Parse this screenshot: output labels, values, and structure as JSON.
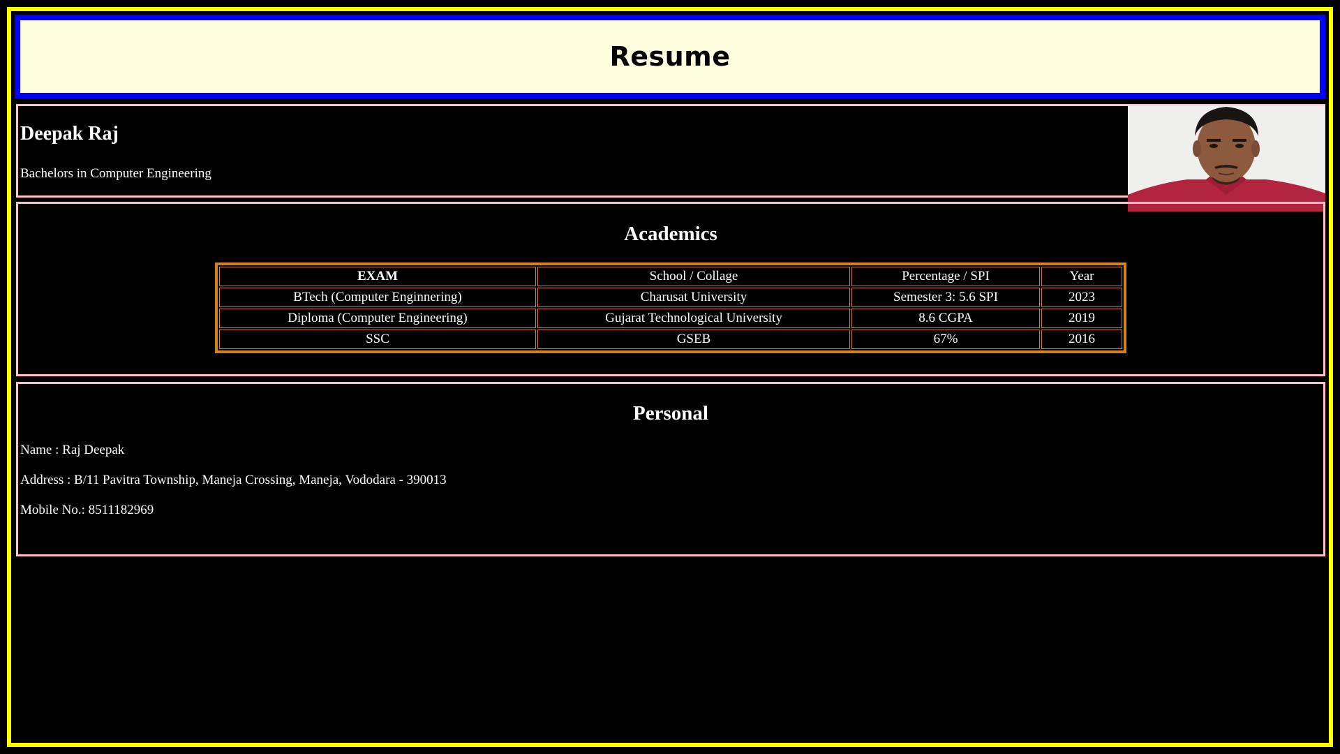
{
  "header": {
    "title": "Resume"
  },
  "profile": {
    "name": "Deepak Raj",
    "degree": "Bachelors in Computer Engineering"
  },
  "academics": {
    "heading": "Academics",
    "columns": [
      "EXAM",
      "School / Collage",
      "Percentage / SPI",
      "Year"
    ],
    "rows": [
      [
        "BTech (Computer Enginnering)",
        "Charusat University",
        "Semester 3: 5.6 SPI",
        "2023"
      ],
      [
        "Diploma (Computer Engineering)",
        "Gujarat Technological University",
        "8.6 CGPA",
        "2019"
      ],
      [
        "SSC",
        "GSEB",
        "67%",
        "2016"
      ]
    ]
  },
  "personal": {
    "heading": "Personal",
    "name_line": "Name : Raj Deepak",
    "address_line": "Address : B/11 Pavitra Township, Maneja Crossing, Maneja, Vododara - 390013",
    "mobile_line": "Mobile No.: 8511182969"
  },
  "colors": {
    "page_border": "#ffff00",
    "header_border": "#0000ff",
    "header_bg": "#ffffe0",
    "section_border": "#ffc0cb",
    "table_border": "#d4811f",
    "background": "#000000"
  }
}
